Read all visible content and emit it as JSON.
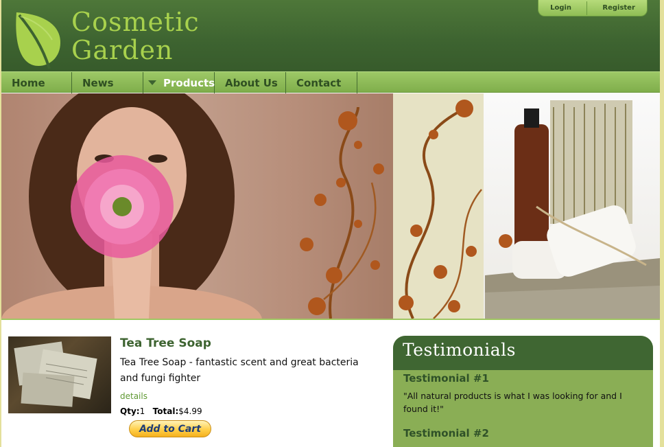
{
  "brand": {
    "line1": "Cosmetic",
    "line2": "Garden",
    "icon": "leaf-icon"
  },
  "account": {
    "login": "Login",
    "register": "Register"
  },
  "nav": {
    "items": [
      {
        "label": "Home"
      },
      {
        "label": "News"
      },
      {
        "label": "Products",
        "active": true,
        "icon": "triangle-down-icon"
      },
      {
        "label": "About Us"
      },
      {
        "label": "Contact"
      }
    ]
  },
  "product": {
    "title": "Tea Tree Soap",
    "description": "Tea Tree Soap - fantastic scent and great bacteria and fungi fighter",
    "details_link": "details",
    "qty_label": "Qty:",
    "qty_value": "1",
    "total_label": "Total:",
    "total_value": "$4.99",
    "add_to_cart": "Add to Cart"
  },
  "testimonials": {
    "heading": "Testimonials",
    "items": [
      {
        "title": "Testimonial #1",
        "text": "\"All natural products is what I was looking for and I found it!\""
      },
      {
        "title": "Testimonial #2",
        "text": ""
      }
    ]
  },
  "colors": {
    "header": "#3d6330",
    "nav": "#8fbd55",
    "accent": "#a8d14d",
    "testimonial_bg": "#8aae55"
  }
}
